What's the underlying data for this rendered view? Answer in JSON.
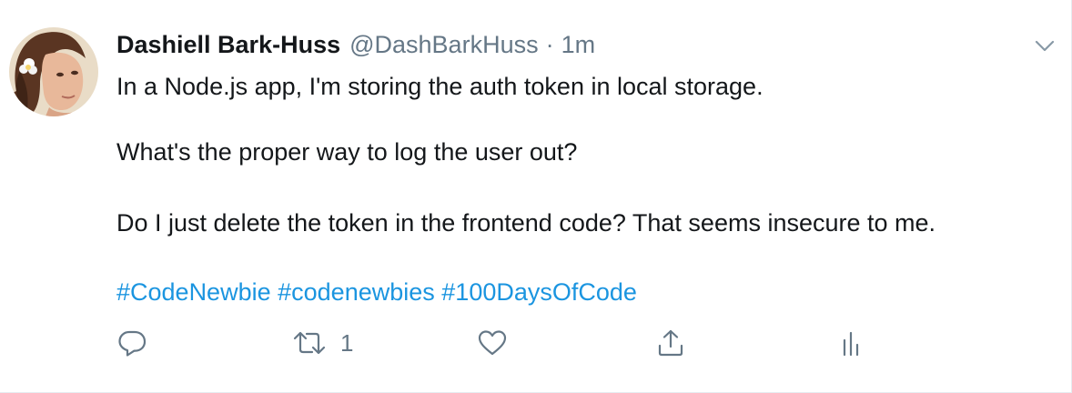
{
  "tweet": {
    "author": {
      "display_name": "Dashiell Bark-Huss",
      "handle": "@DashBarkHuss",
      "separator": "·",
      "time": "1m"
    },
    "body": {
      "line1": "In a Node.js app, I'm storing the auth token in local storage.",
      "line2": "What's the proper way to log the user out?",
      "line3": "Do I just delete the token in the frontend code? That seems insecure to me."
    },
    "hashtags": [
      "#CodeNewbie",
      "#codenewbies",
      "#100DaysOfCode"
    ],
    "actions": {
      "reply": {
        "icon": "reply-icon",
        "count": ""
      },
      "retweet": {
        "icon": "retweet-icon",
        "count": "1"
      },
      "like": {
        "icon": "heart-icon",
        "count": ""
      },
      "share": {
        "icon": "share-icon"
      },
      "analytics": {
        "icon": "analytics-icon"
      }
    },
    "menu_icon": "chevron-down-icon"
  },
  "colors": {
    "text": "#14171a",
    "muted": "#657786",
    "link": "#1b95e0",
    "border": "#e6ecf0"
  }
}
